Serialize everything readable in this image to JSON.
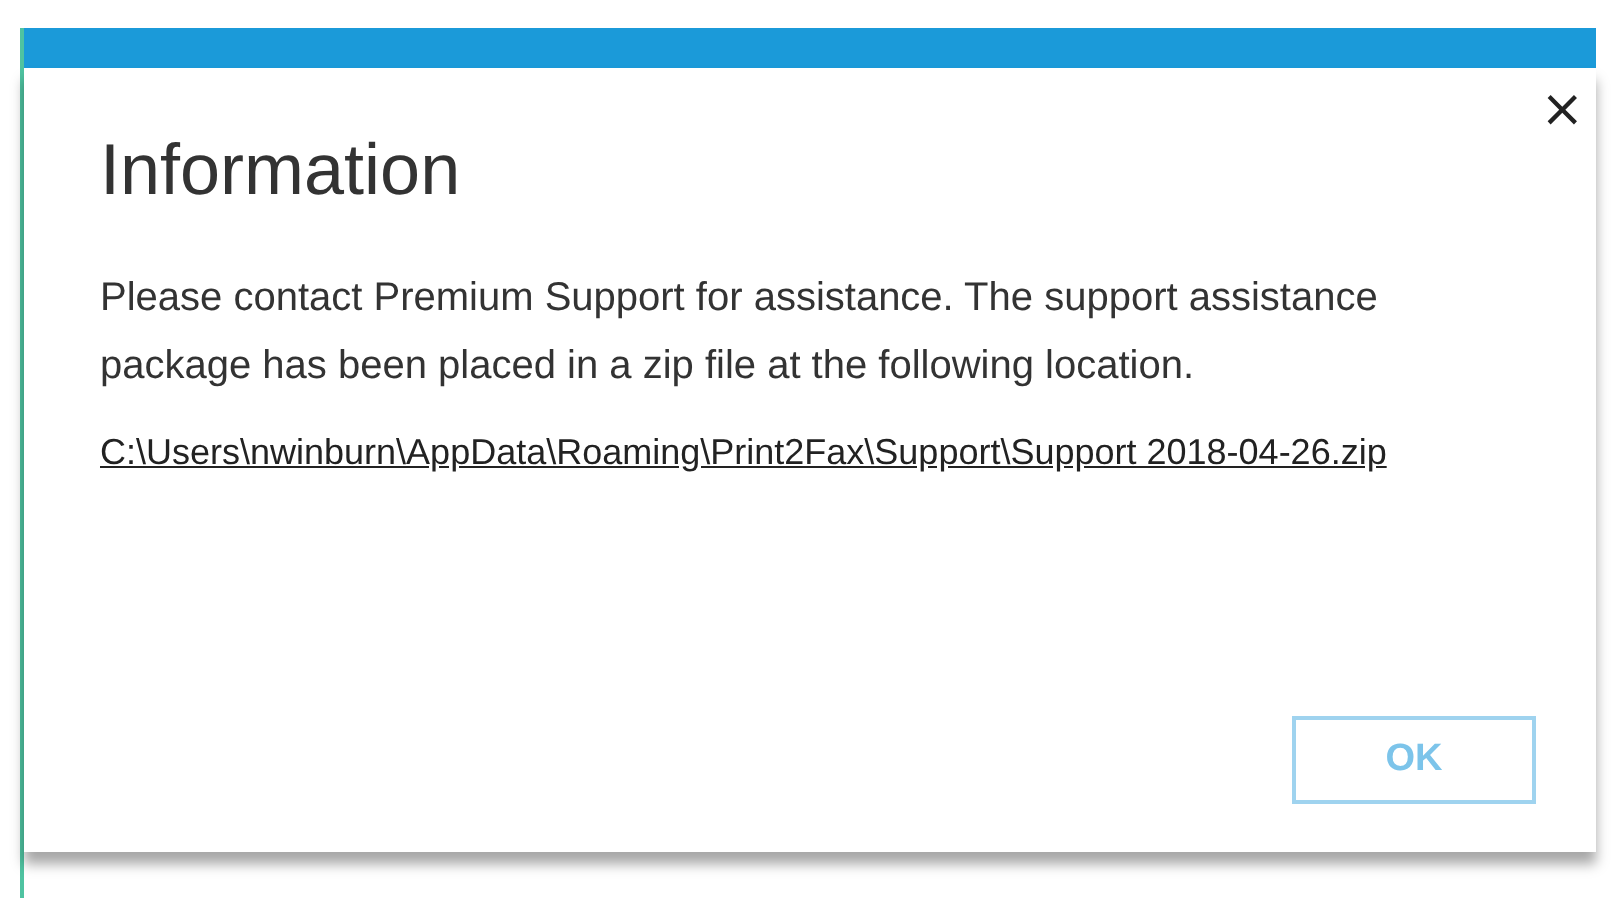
{
  "dialog": {
    "title": "Information",
    "message": "Please contact Premium Support for assistance. The support assistance package has been placed in a zip file at the following location.",
    "link": "C:\\Users\\nwinburn\\AppData\\Roaming\\Print2Fax\\Support\\Support 2018-04-26.zip",
    "close": "×",
    "buttons": [
      "OK"
    ]
  }
}
